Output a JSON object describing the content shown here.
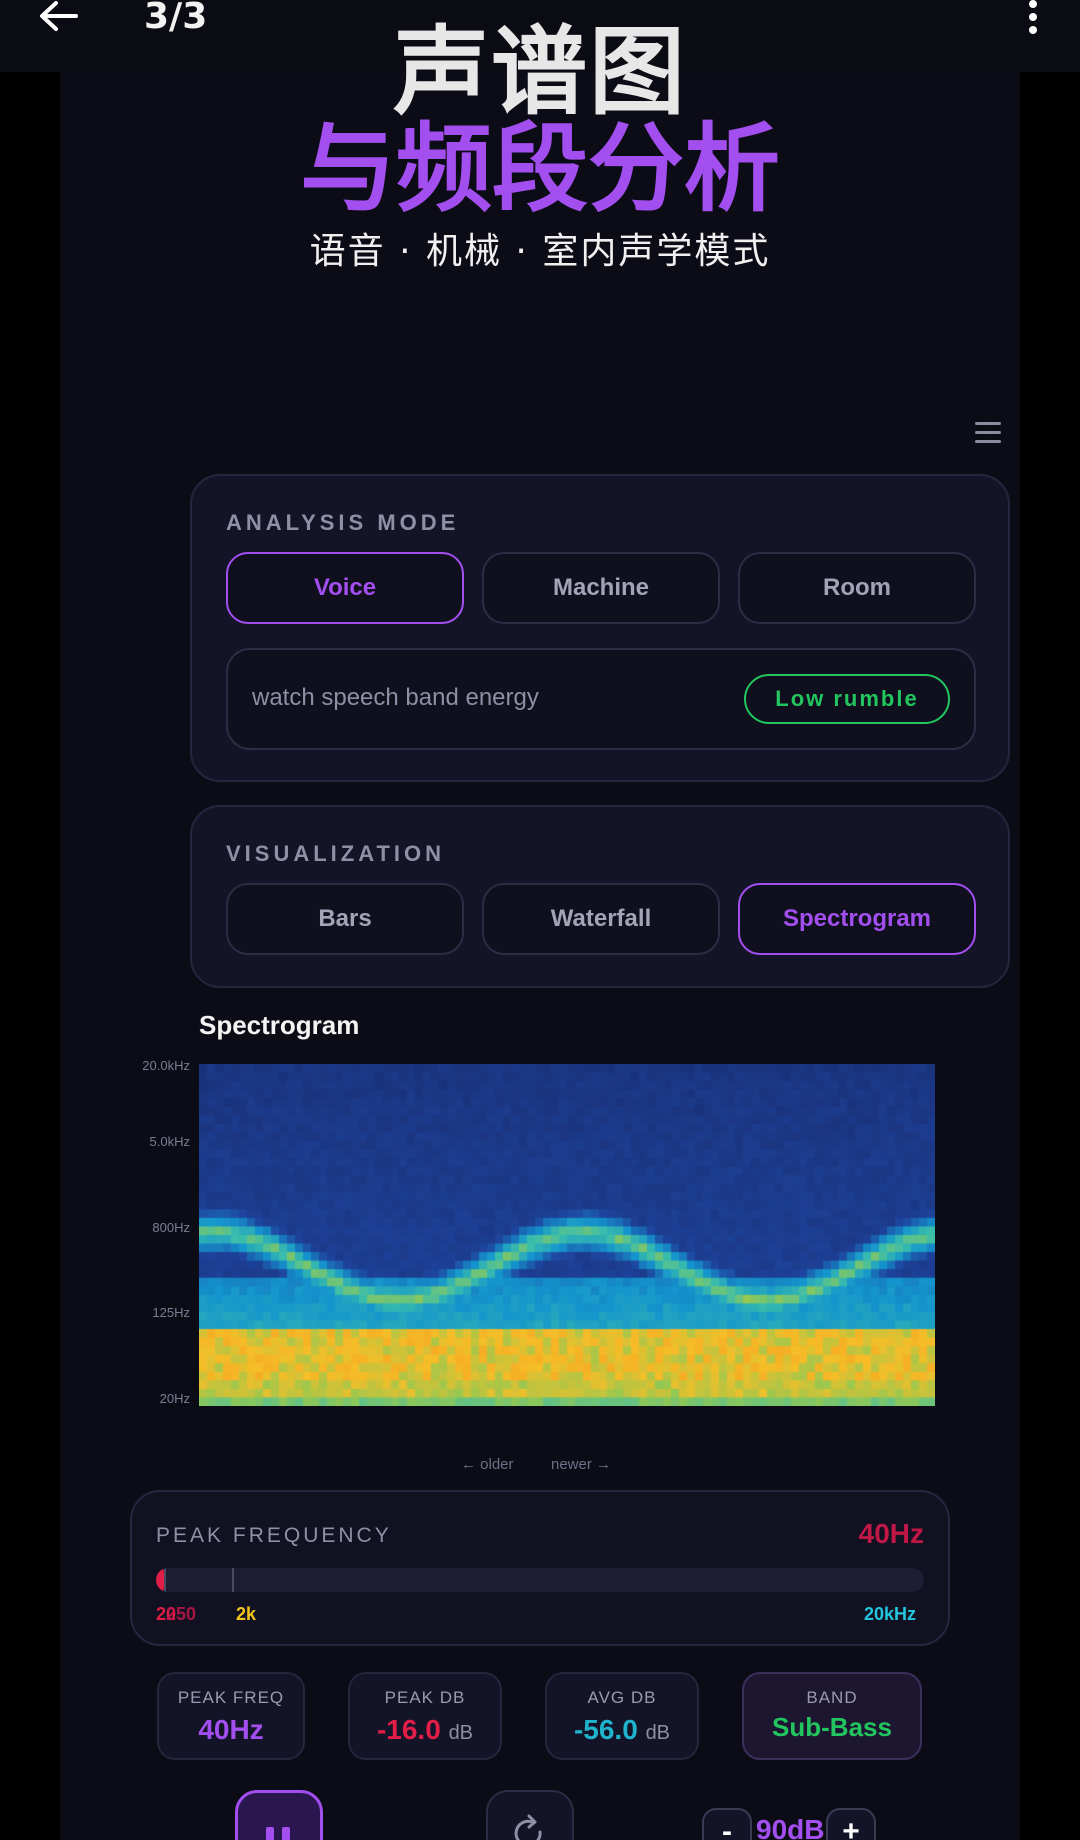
{
  "topbar": {
    "counter": "3/3"
  },
  "hero": {
    "title": "声谱图",
    "subtitle": "与频段分析",
    "modes_line": "语音 ·  机械 ·  室内声学模式"
  },
  "analysis": {
    "label": "ANALYSIS MODE",
    "options": [
      "Voice",
      "Machine",
      "Room"
    ],
    "selected": "Voice",
    "hint": "watch speech band energy",
    "badge": "Low rumble"
  },
  "visualization": {
    "label": "VISUALIZATION",
    "options": [
      "Bars",
      "Waterfall",
      "Spectrogram"
    ],
    "selected": "Spectrogram"
  },
  "spectrogram": {
    "title": "Spectrogram",
    "y_ticks": [
      "20.0kHz",
      "5.0kHz",
      "800Hz",
      "125Hz",
      "20Hz"
    ],
    "older": "← older",
    "newer": "newer →"
  },
  "peak": {
    "label": "PEAK FREQUENCY",
    "value": "40Hz",
    "fill_fraction": 0.01,
    "scale": {
      "a": "20",
      "b": "250",
      "c": "2k",
      "d": "20kHz"
    }
  },
  "stats": {
    "peak_freq": {
      "label": "PEAK FREQ",
      "value": "40Hz"
    },
    "peak_db": {
      "label": "PEAK DB",
      "value": "-16.0",
      "unit": "dB"
    },
    "avg_db": {
      "label": "AVG DB",
      "value": "-56.0",
      "unit": "dB"
    },
    "band": {
      "label": "BAND",
      "value": "Sub-Bass"
    }
  },
  "controls": {
    "minus": "-",
    "db": "90dB",
    "plus": "+"
  },
  "colors": {
    "accent": "#a34ff0",
    "peak_red": "#c11747",
    "band_green": "#22c55e",
    "avg_cyan": "#1fb3cc",
    "scale_yellow": "#f0c419",
    "scale_cyan": "#22c5dc"
  }
}
